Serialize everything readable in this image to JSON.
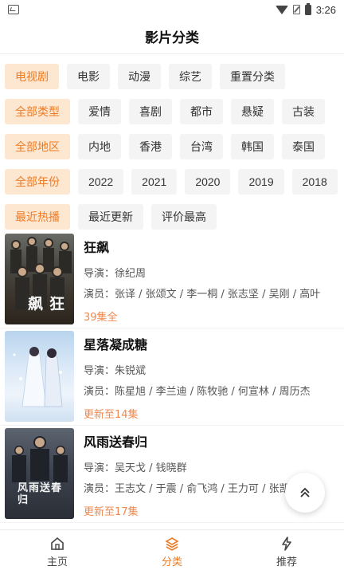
{
  "status_bar": {
    "time": "3:26"
  },
  "header": {
    "title": "影片分类"
  },
  "filters": {
    "row_type": [
      "电视剧",
      "电影",
      "动漫",
      "综艺",
      "重置分类"
    ],
    "row_genre": [
      "全部类型",
      "爱情",
      "喜剧",
      "都市",
      "悬疑",
      "古装"
    ],
    "row_region": [
      "全部地区",
      "内地",
      "香港",
      "台湾",
      "韩国",
      "泰国"
    ],
    "row_year": [
      "全部年份",
      "2022",
      "2021",
      "2020",
      "2019",
      "2018"
    ],
    "row_sort": [
      "最近热播",
      "最近更新",
      "评价最高"
    ]
  },
  "items": [
    {
      "title": "狂飙",
      "director": "导演：徐纪周",
      "actors": "演员：张译 / 张颂文 / 李一桐 / 张志坚 / 吴刚 / 高叶",
      "status": "39集全",
      "poster_caption": "狂飙"
    },
    {
      "title": "星落凝成糖",
      "director": "导演：朱锐斌",
      "actors": "演员：陈星旭 / 李兰迪 / 陈牧驰 / 何宣林 / 周历杰",
      "status": "更新至14集",
      "poster_caption": ""
    },
    {
      "title": "风雨送春归",
      "director": "导演：吴天戈 / 钱晓群",
      "actors": "演员：王志文 / 于震 / 俞飞鸿 / 王力可 / 张凯丽",
      "status": "更新至17集",
      "poster_caption": "风雨送春归"
    }
  ],
  "tabbar": {
    "home": "主页",
    "category": "分类",
    "recommend": "推荐"
  }
}
